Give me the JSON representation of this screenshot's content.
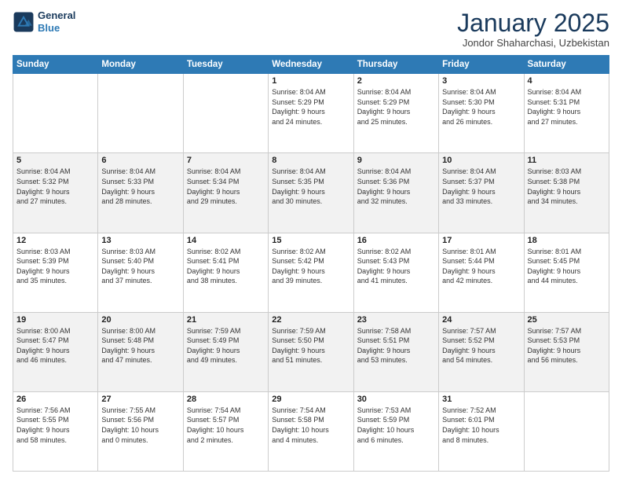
{
  "header": {
    "logo_line1": "General",
    "logo_line2": "Blue",
    "month": "January 2025",
    "location": "Jondor Shaharchasi, Uzbekistan"
  },
  "weekdays": [
    "Sunday",
    "Monday",
    "Tuesday",
    "Wednesday",
    "Thursday",
    "Friday",
    "Saturday"
  ],
  "weeks": [
    [
      {
        "day": "",
        "info": ""
      },
      {
        "day": "",
        "info": ""
      },
      {
        "day": "",
        "info": ""
      },
      {
        "day": "1",
        "info": "Sunrise: 8:04 AM\nSunset: 5:29 PM\nDaylight: 9 hours\nand 24 minutes."
      },
      {
        "day": "2",
        "info": "Sunrise: 8:04 AM\nSunset: 5:29 PM\nDaylight: 9 hours\nand 25 minutes."
      },
      {
        "day": "3",
        "info": "Sunrise: 8:04 AM\nSunset: 5:30 PM\nDaylight: 9 hours\nand 26 minutes."
      },
      {
        "day": "4",
        "info": "Sunrise: 8:04 AM\nSunset: 5:31 PM\nDaylight: 9 hours\nand 27 minutes."
      }
    ],
    [
      {
        "day": "5",
        "info": "Sunrise: 8:04 AM\nSunset: 5:32 PM\nDaylight: 9 hours\nand 27 minutes."
      },
      {
        "day": "6",
        "info": "Sunrise: 8:04 AM\nSunset: 5:33 PM\nDaylight: 9 hours\nand 28 minutes."
      },
      {
        "day": "7",
        "info": "Sunrise: 8:04 AM\nSunset: 5:34 PM\nDaylight: 9 hours\nand 29 minutes."
      },
      {
        "day": "8",
        "info": "Sunrise: 8:04 AM\nSunset: 5:35 PM\nDaylight: 9 hours\nand 30 minutes."
      },
      {
        "day": "9",
        "info": "Sunrise: 8:04 AM\nSunset: 5:36 PM\nDaylight: 9 hours\nand 32 minutes."
      },
      {
        "day": "10",
        "info": "Sunrise: 8:04 AM\nSunset: 5:37 PM\nDaylight: 9 hours\nand 33 minutes."
      },
      {
        "day": "11",
        "info": "Sunrise: 8:03 AM\nSunset: 5:38 PM\nDaylight: 9 hours\nand 34 minutes."
      }
    ],
    [
      {
        "day": "12",
        "info": "Sunrise: 8:03 AM\nSunset: 5:39 PM\nDaylight: 9 hours\nand 35 minutes."
      },
      {
        "day": "13",
        "info": "Sunrise: 8:03 AM\nSunset: 5:40 PM\nDaylight: 9 hours\nand 37 minutes."
      },
      {
        "day": "14",
        "info": "Sunrise: 8:02 AM\nSunset: 5:41 PM\nDaylight: 9 hours\nand 38 minutes."
      },
      {
        "day": "15",
        "info": "Sunrise: 8:02 AM\nSunset: 5:42 PM\nDaylight: 9 hours\nand 39 minutes."
      },
      {
        "day": "16",
        "info": "Sunrise: 8:02 AM\nSunset: 5:43 PM\nDaylight: 9 hours\nand 41 minutes."
      },
      {
        "day": "17",
        "info": "Sunrise: 8:01 AM\nSunset: 5:44 PM\nDaylight: 9 hours\nand 42 minutes."
      },
      {
        "day": "18",
        "info": "Sunrise: 8:01 AM\nSunset: 5:45 PM\nDaylight: 9 hours\nand 44 minutes."
      }
    ],
    [
      {
        "day": "19",
        "info": "Sunrise: 8:00 AM\nSunset: 5:47 PM\nDaylight: 9 hours\nand 46 minutes."
      },
      {
        "day": "20",
        "info": "Sunrise: 8:00 AM\nSunset: 5:48 PM\nDaylight: 9 hours\nand 47 minutes."
      },
      {
        "day": "21",
        "info": "Sunrise: 7:59 AM\nSunset: 5:49 PM\nDaylight: 9 hours\nand 49 minutes."
      },
      {
        "day": "22",
        "info": "Sunrise: 7:59 AM\nSunset: 5:50 PM\nDaylight: 9 hours\nand 51 minutes."
      },
      {
        "day": "23",
        "info": "Sunrise: 7:58 AM\nSunset: 5:51 PM\nDaylight: 9 hours\nand 53 minutes."
      },
      {
        "day": "24",
        "info": "Sunrise: 7:57 AM\nSunset: 5:52 PM\nDaylight: 9 hours\nand 54 minutes."
      },
      {
        "day": "25",
        "info": "Sunrise: 7:57 AM\nSunset: 5:53 PM\nDaylight: 9 hours\nand 56 minutes."
      }
    ],
    [
      {
        "day": "26",
        "info": "Sunrise: 7:56 AM\nSunset: 5:55 PM\nDaylight: 9 hours\nand 58 minutes."
      },
      {
        "day": "27",
        "info": "Sunrise: 7:55 AM\nSunset: 5:56 PM\nDaylight: 10 hours\nand 0 minutes."
      },
      {
        "day": "28",
        "info": "Sunrise: 7:54 AM\nSunset: 5:57 PM\nDaylight: 10 hours\nand 2 minutes."
      },
      {
        "day": "29",
        "info": "Sunrise: 7:54 AM\nSunset: 5:58 PM\nDaylight: 10 hours\nand 4 minutes."
      },
      {
        "day": "30",
        "info": "Sunrise: 7:53 AM\nSunset: 5:59 PM\nDaylight: 10 hours\nand 6 minutes."
      },
      {
        "day": "31",
        "info": "Sunrise: 7:52 AM\nSunset: 6:01 PM\nDaylight: 10 hours\nand 8 minutes."
      },
      {
        "day": "",
        "info": ""
      }
    ]
  ]
}
